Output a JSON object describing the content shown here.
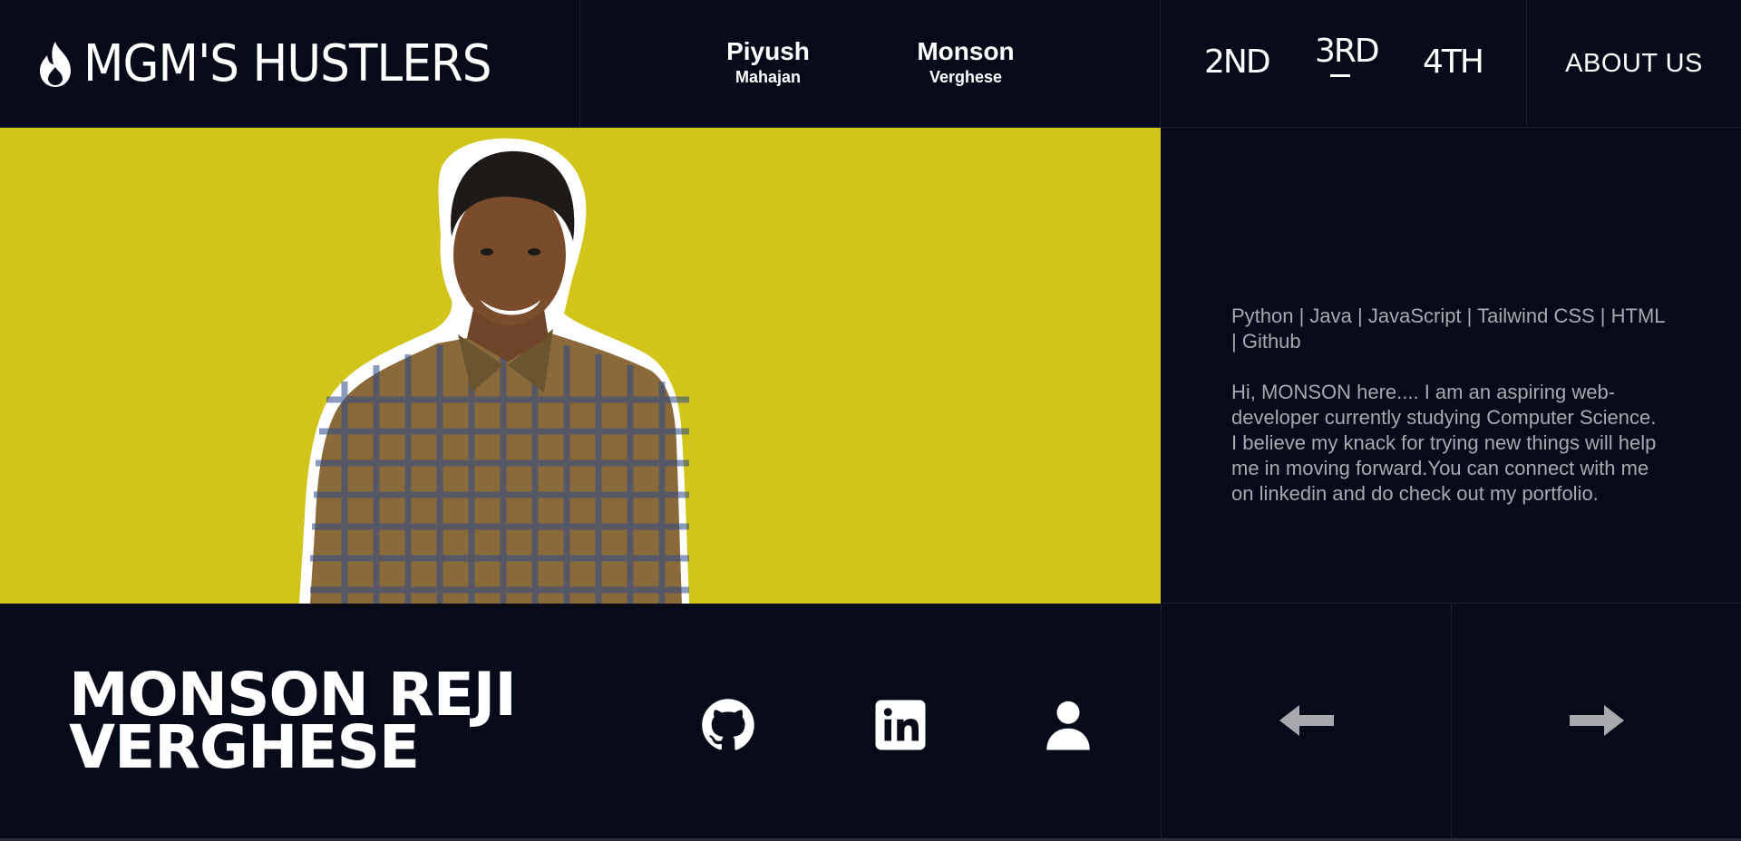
{
  "brand": {
    "title": "MGM'S HUSTLERS",
    "icon": "flame-icon"
  },
  "members": [
    {
      "first": "Piyush",
      "last": "Mahajan"
    },
    {
      "first": "Monson",
      "last": "Verghese"
    }
  ],
  "years": [
    {
      "label": "2ND"
    },
    {
      "label": "3RD",
      "active": true
    },
    {
      "label": "4TH"
    }
  ],
  "about": "ABOUT US",
  "profile": {
    "skills": "Python | Java | JavaScript | Tailwind CSS | HTML | Github",
    "bio": "Hi, MONSON here.... I am an aspiring web-developer currently studying Computer Science. I believe my knack for trying new things will help me in moving forward.You can connect with me on linkedin and do check out my portfolio.",
    "name_line1": "MONSON REJI",
    "name_line2": "VERGHESE"
  },
  "social": [
    "github-icon",
    "linkedin-icon",
    "user-icon"
  ],
  "navigation": [
    "arrow-left-icon",
    "arrow-right-icon"
  ],
  "colors": {
    "background": "#070b19",
    "photo_bg": "#d1c41b",
    "muted_text": "#a7a9ae"
  }
}
